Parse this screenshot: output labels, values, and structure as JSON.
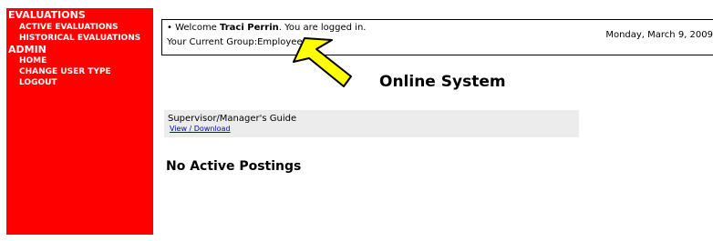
{
  "sidebar": {
    "sections": [
      {
        "title": "EVALUATIONS",
        "items": [
          "ACTIVE EVALUATIONS",
          "HISTORICAL EVALUATIONS"
        ]
      },
      {
        "title": "ADMIN",
        "items": [
          "HOME",
          "CHANGE USER TYPE",
          "LOGOUT"
        ]
      }
    ],
    "background_color": "#ff0000",
    "text_color": "#ffffff"
  },
  "welcome": {
    "bullet": "•",
    "prefix": "Welcome ",
    "user_name": "Traci Perrin",
    "suffix": ". You are logged in.",
    "group_label": "Your Current Group:",
    "group_value": "Employee.",
    "date": "Monday, March 9, 2009"
  },
  "main": {
    "title": "Online System",
    "guide": {
      "title": "Supervisor/Manager's Guide",
      "link_label": "View / Download"
    },
    "postings_heading": "No Active Postings"
  },
  "annotation": {
    "arrow_icon": "yellow-callout-arrow",
    "arrow_color": "#ffff00"
  }
}
